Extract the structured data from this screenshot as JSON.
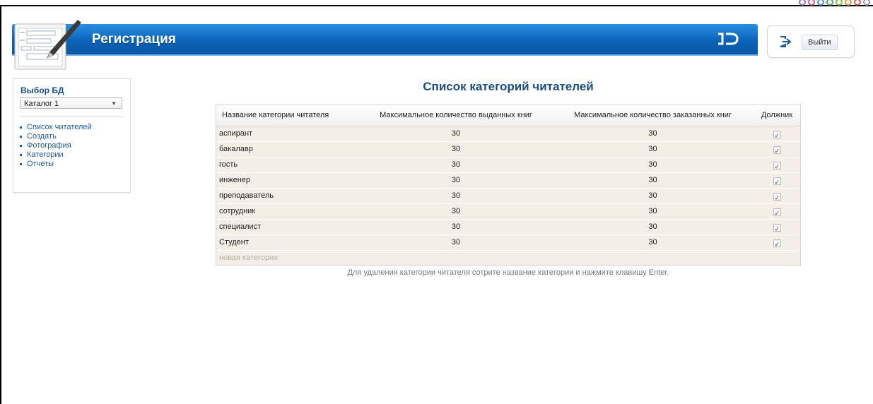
{
  "header": {
    "title": "Регистрация",
    "exit_label": "Выйти"
  },
  "sidebar": {
    "db_title": "Выбор БД",
    "db_selected": "Каталог 1",
    "items": [
      {
        "label": "Список читателей"
      },
      {
        "label": "Создать"
      },
      {
        "label": "Фотография"
      },
      {
        "label": "Категории"
      },
      {
        "label": "Отчеты"
      }
    ]
  },
  "main": {
    "title": "Список категорий читателей",
    "columns": [
      "Название категории читателя",
      "Максимальное количество выданных книг",
      "Максимальное количество заказанных книг",
      "Должник"
    ],
    "rows": [
      {
        "name": "аспирант",
        "max_issued": "30",
        "max_ordered": "30",
        "debtor": true
      },
      {
        "name": "бакалавр",
        "max_issued": "30",
        "max_ordered": "30",
        "debtor": true
      },
      {
        "name": "гость",
        "max_issued": "30",
        "max_ordered": "30",
        "debtor": true
      },
      {
        "name": "инженер",
        "max_issued": "30",
        "max_ordered": "30",
        "debtor": true
      },
      {
        "name": "преподаватель",
        "max_issued": "30",
        "max_ordered": "30",
        "debtor": true
      },
      {
        "name": "сотрудник",
        "max_issued": "30",
        "max_ordered": "30",
        "debtor": true
      },
      {
        "name": "специалист",
        "max_issued": "30",
        "max_ordered": "30",
        "debtor": true
      },
      {
        "name": "Студент",
        "max_issued": "30",
        "max_ordered": "30",
        "debtor": true
      }
    ],
    "new_row_placeholder": "новая категория",
    "hint": "Для удаления категории читателя сотрите название категории и нажмите клавишу Enter."
  },
  "colors": {
    "banner": "#0b63b8",
    "title": "#1a4f86",
    "row_bg": "#f4eee6"
  }
}
